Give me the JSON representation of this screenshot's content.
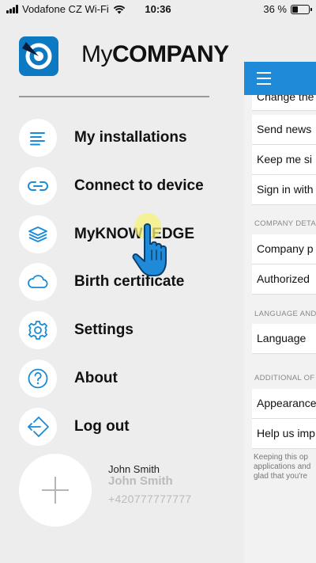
{
  "status_bar": {
    "carrier": "Vodafone CZ Wi-Fi",
    "time": "10:36",
    "battery": "36 %",
    "battery_level": 0.36
  },
  "header": {
    "brand_thin": "My",
    "brand_bold": "COMPANY",
    "logo_icon": "company-logo-icon"
  },
  "menu": {
    "items": [
      {
        "label": "My installations",
        "icon": "list-icon"
      },
      {
        "label": "Connect to device",
        "icon": "link-icon"
      },
      {
        "label": "MyKNOWLEDGE",
        "icon": "layers-icon"
      },
      {
        "label": "Birth certificate",
        "icon": "cloud-icon"
      },
      {
        "label": "Settings",
        "icon": "gear-icon"
      },
      {
        "label": "About",
        "icon": "question-icon"
      },
      {
        "label": "Log out",
        "icon": "logout-icon"
      }
    ]
  },
  "profile": {
    "name": "John Smith",
    "name_placeholder": "John Smith",
    "phone": "+420777777777",
    "avatar_icon": "plus-icon"
  },
  "background_panel": {
    "rows_top": [
      "Change the",
      "Send news",
      "Keep me si",
      "Sign in with"
    ],
    "section_company": "COMPANY DETA",
    "rows_company": [
      "Company p",
      "Authorized"
    ],
    "section_language": "LANGUAGE AND",
    "rows_language": [
      "Language"
    ],
    "section_additional": "ADDITIONAL OF",
    "rows_additional": [
      "Appearance",
      "Help us imp"
    ],
    "footer_lines": [
      "Keeping this op",
      "applications and",
      "glad that you're"
    ]
  },
  "colors": {
    "accent": "#1e8ad8",
    "logo_blue": "#0d79c3",
    "icon_blue": "#1a8bd6",
    "drawer_bg": "#ededed",
    "tap_highlight": "#f7f27a"
  }
}
